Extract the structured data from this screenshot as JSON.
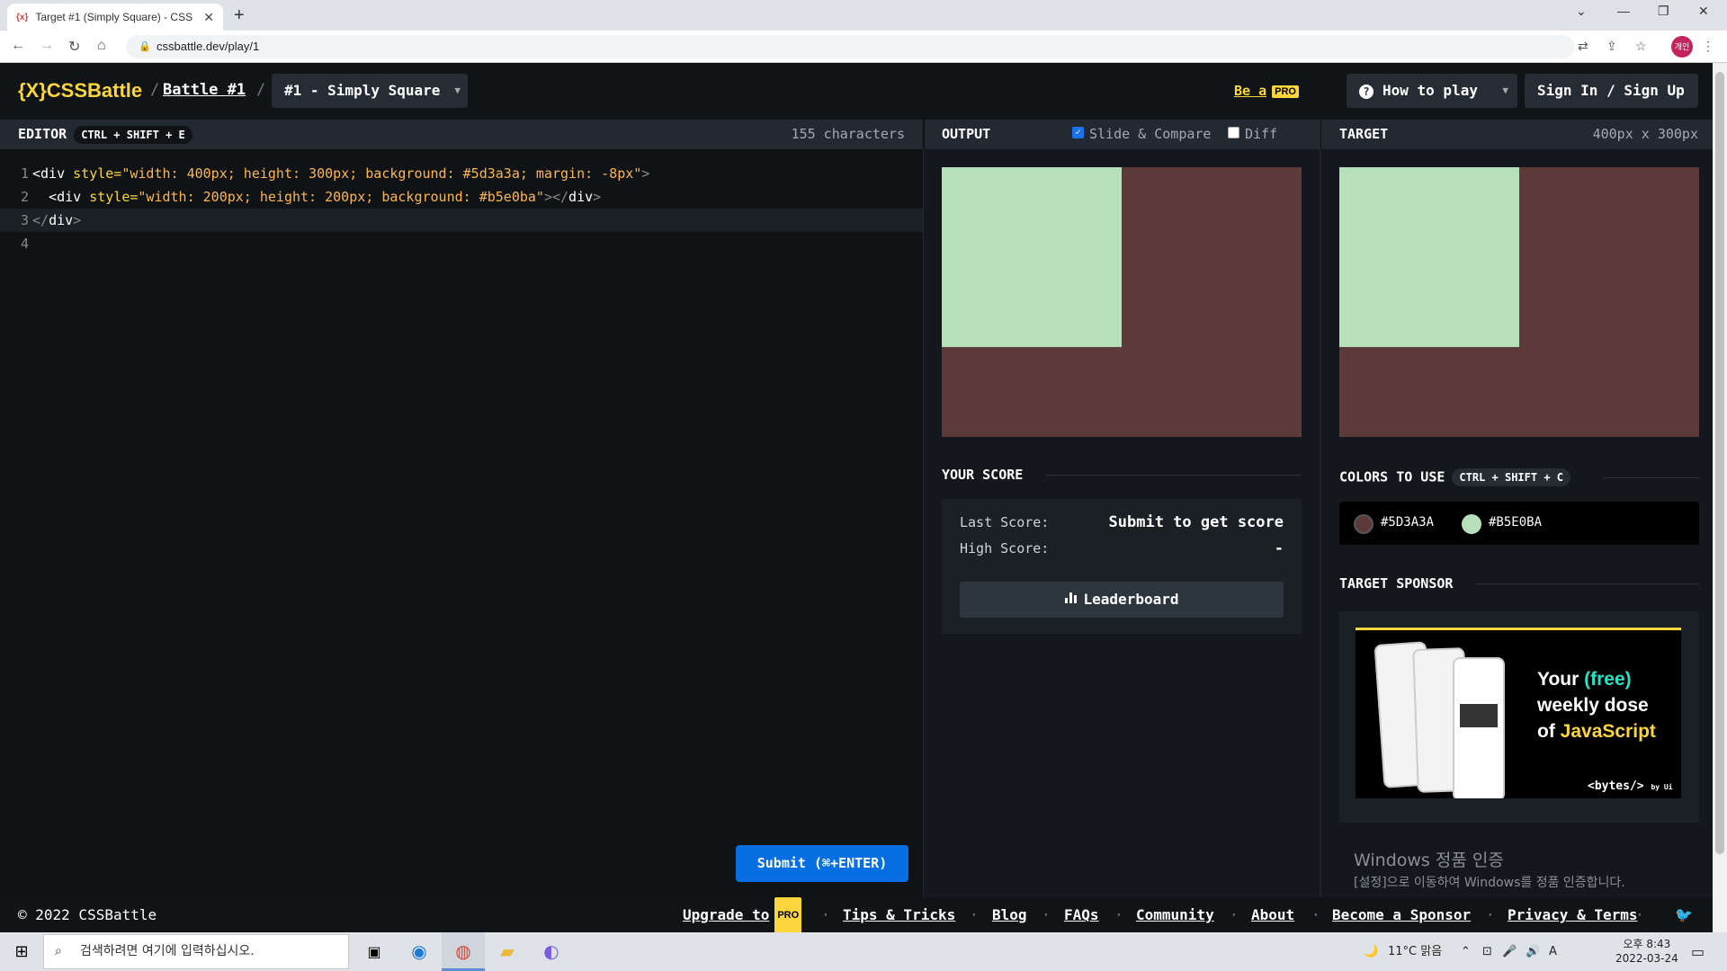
{
  "browser": {
    "tab_title": "Target #1 (Simply Square) - CSS",
    "tab_favicon": "{x}",
    "url": "cssbattle.dev/play/1",
    "avatar_text": "개인"
  },
  "header": {
    "logo": "{X}CSSBattle",
    "crumb_battle": "Battle #1",
    "crumb_sep": "/",
    "target_select": "#1 - Simply Square",
    "be_a": "Be a",
    "pro_badge": "PRO",
    "how_to_play": "How to play",
    "sign_in": "Sign In / Sign Up"
  },
  "editor": {
    "title": "EDITOR",
    "shortcut": "CTRL + SHIFT + E",
    "char_count": "155 characters",
    "line_numbers": [
      "1",
      "2",
      "3",
      "4"
    ],
    "line1": {
      "tag": "<div",
      "attr": " style=",
      "val": "\"width: 400px; height: 300px; background: #5d3a3a; margin: -8px\"",
      "end": ">"
    },
    "line2": {
      "indent": "  ",
      "tag": "<div",
      "attr": " style=",
      "val": "\"width: 200px; height: 200px; background: #b5e0ba\"",
      "end": "></",
      "close": "div",
      "gt": ">"
    },
    "line3": {
      "open": "</",
      "tag": "div",
      "end": ">"
    },
    "submit": "Submit (⌘+ENTER)"
  },
  "output": {
    "title": "OUTPUT",
    "slide_compare": "Slide & Compare",
    "slide_compare_checked": true,
    "diff": "Diff",
    "diff_checked": false
  },
  "target": {
    "title": "TARGET",
    "size": "400px x 300px"
  },
  "score": {
    "title": "YOUR SCORE",
    "last_label": "Last Score:",
    "last_value": "Submit to get score",
    "high_label": "High Score:",
    "high_value": "-",
    "leaderboard": "Leaderboard"
  },
  "colors": {
    "title": "COLORS TO USE",
    "shortcut": "CTRL + SHIFT + C",
    "items": [
      {
        "hex": "#5D3A3A",
        "swatch": "#5d3a3a"
      },
      {
        "hex": "#B5E0BA",
        "swatch": "#b5e0ba"
      }
    ]
  },
  "sponsor": {
    "title": "TARGET SPONSOR",
    "line1": "Your ",
    "free": "(free)",
    "line2": "weekly dose",
    "line3_pre": "of ",
    "line3_js": "JavaScript",
    "brand": "<bytes/>",
    "brand_by": "by Ui"
  },
  "watermark": {
    "title": "Windows 정품 인증",
    "sub": "[설정]으로 이동하여 Windows를 정품 인증합니다."
  },
  "footer": {
    "copyright": "© 2022 CSSBattle",
    "upgrade": "Upgrade to",
    "links": [
      "Tips & Tricks",
      "Blog",
      "FAQs",
      "Community",
      "About",
      "Become a Sponsor",
      "Privacy & Terms"
    ],
    "dot": "·"
  },
  "taskbar": {
    "search_placeholder": "검색하려면 여기에 입력하십시오.",
    "weather": "11°C 맑음",
    "ime": "A",
    "time_period": "오후 8:43",
    "date": "2022-03-24"
  },
  "palette": {
    "brand_yellow": "#fbd53c",
    "submit_blue": "#086fe3",
    "target_bg": "#5d3a3a",
    "target_square": "#b5e0ba"
  }
}
